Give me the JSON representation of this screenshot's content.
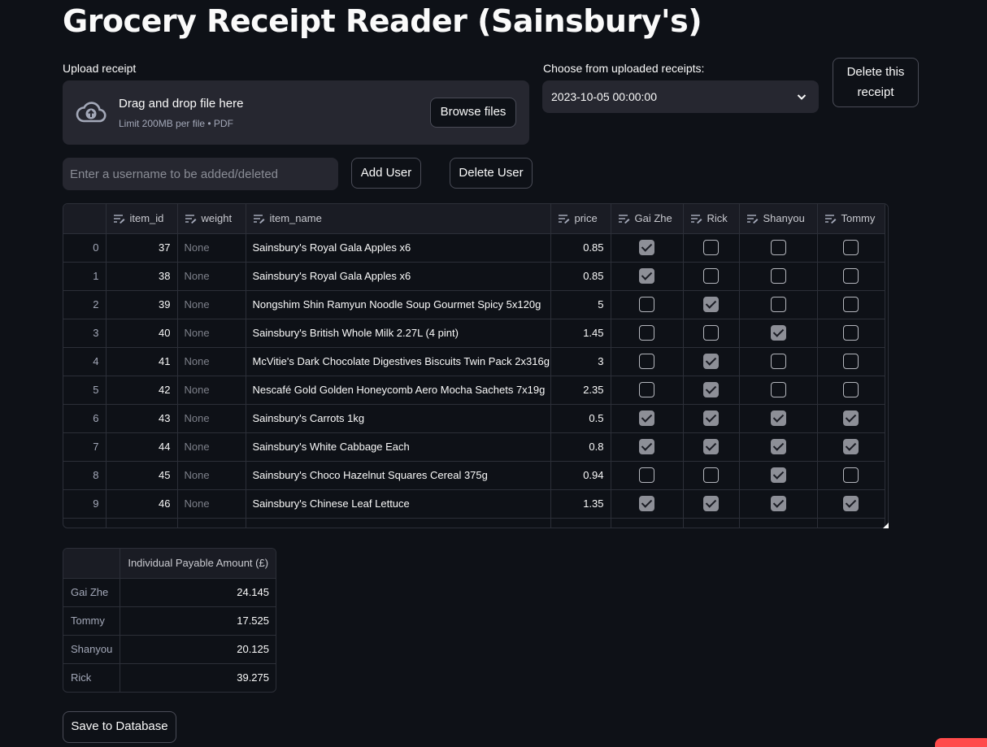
{
  "title": "Grocery Receipt Reader (Sainsbury's)",
  "upload": {
    "label": "Upload receipt",
    "drop_text": "Drag and drop file here",
    "limit_text": "Limit 200MB per file • PDF",
    "browse_label": "Browse files"
  },
  "receipt_select": {
    "label": "Choose from uploaded receipts:",
    "selected": "2023-10-05 00:00:00"
  },
  "delete_receipt_label": "Delete this receipt",
  "username": {
    "placeholder": "Enter a username to be added/deleted",
    "value": ""
  },
  "add_user_label": "Add User",
  "delete_user_label": "Delete User",
  "items_table": {
    "columns": [
      "item_id",
      "weight",
      "item_name",
      "price",
      "Gai Zhe",
      "Rick",
      "Shanyou",
      "Tommy"
    ],
    "rows": [
      {
        "idx": "0",
        "item_id": "37",
        "weight": "None",
        "item_name": "Sainsbury's Royal Gala Apples x6",
        "price": "0.85",
        "checks": [
          true,
          false,
          false,
          false
        ]
      },
      {
        "idx": "1",
        "item_id": "38",
        "weight": "None",
        "item_name": "Sainsbury's Royal Gala Apples x6",
        "price": "0.85",
        "checks": [
          true,
          false,
          false,
          false
        ]
      },
      {
        "idx": "2",
        "item_id": "39",
        "weight": "None",
        "item_name": "Nongshim Shin Ramyun Noodle Soup Gourmet Spicy 5x120g",
        "price": "5",
        "checks": [
          false,
          true,
          false,
          false
        ]
      },
      {
        "idx": "3",
        "item_id": "40",
        "weight": "None",
        "item_name": "Sainsbury's British Whole Milk 2.27L (4 pint)",
        "price": "1.45",
        "checks": [
          false,
          false,
          true,
          false
        ]
      },
      {
        "idx": "4",
        "item_id": "41",
        "weight": "None",
        "item_name": "McVitie's Dark Chocolate Digestives Biscuits Twin Pack 2x316g",
        "price": "3",
        "checks": [
          false,
          true,
          false,
          false
        ]
      },
      {
        "idx": "5",
        "item_id": "42",
        "weight": "None",
        "item_name": "Nescafé Gold Golden Honeycomb Aero Mocha Sachets 7x19g",
        "price": "2.35",
        "checks": [
          false,
          true,
          false,
          false
        ]
      },
      {
        "idx": "6",
        "item_id": "43",
        "weight": "None",
        "item_name": "Sainsbury's Carrots 1kg",
        "price": "0.5",
        "checks": [
          true,
          true,
          true,
          true
        ]
      },
      {
        "idx": "7",
        "item_id": "44",
        "weight": "None",
        "item_name": "Sainsbury's White Cabbage Each",
        "price": "0.8",
        "checks": [
          true,
          true,
          true,
          true
        ]
      },
      {
        "idx": "8",
        "item_id": "45",
        "weight": "None",
        "item_name": "Sainsbury's Choco Hazelnut Squares Cereal 375g",
        "price": "0.94",
        "checks": [
          false,
          false,
          true,
          false
        ]
      },
      {
        "idx": "9",
        "item_id": "46",
        "weight": "None",
        "item_name": "Sainsbury's Chinese Leaf Lettuce",
        "price": "1.35",
        "checks": [
          true,
          true,
          true,
          true
        ]
      }
    ]
  },
  "summary": {
    "header": "Individual Payable Amount (£)",
    "rows": [
      {
        "name": "Gai Zhe",
        "amount": "24.145"
      },
      {
        "name": "Tommy",
        "amount": "17.525"
      },
      {
        "name": "Shanyou",
        "amount": "20.125"
      },
      {
        "name": "Rick",
        "amount": "39.275"
      }
    ]
  },
  "save_label": "Save to Database",
  "colors": {
    "background": "#0e1117",
    "input_bg": "#262730",
    "accent": "#ff4b4b",
    "checked": "#8d8f97"
  }
}
